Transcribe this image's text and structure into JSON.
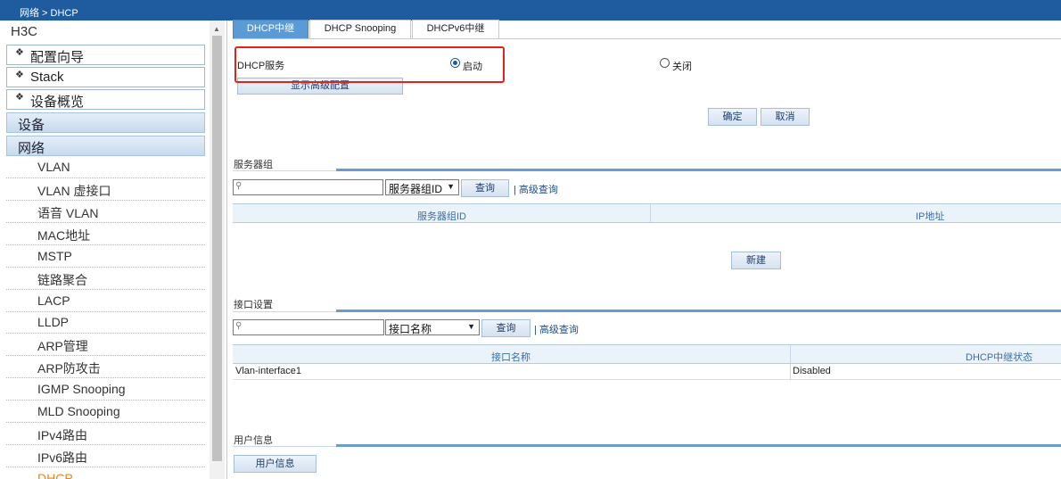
{
  "breadcrumb": "网络 > DHCP",
  "sidebar": {
    "brand": "H3C",
    "heads": [
      "配置向导",
      "Stack",
      "设备概览"
    ],
    "sections": [
      "设备",
      "网络"
    ],
    "items": [
      {
        "label": "VLAN"
      },
      {
        "label": "VLAN 虚接口"
      },
      {
        "label": "语音 VLAN"
      },
      {
        "label": "MAC地址"
      },
      {
        "label": "MSTP"
      },
      {
        "label": "链路聚合"
      },
      {
        "label": "LACP"
      },
      {
        "label": "LLDP"
      },
      {
        "label": "ARP管理"
      },
      {
        "label": "ARP防攻击"
      },
      {
        "label": "IGMP Snooping"
      },
      {
        "label": "MLD Snooping"
      },
      {
        "label": "IPv4路由"
      },
      {
        "label": "IPv6路由"
      },
      {
        "label": "DHCP"
      }
    ]
  },
  "tabs": [
    "DHCP中继",
    "DHCP Snooping",
    "DHCPv6中继"
  ],
  "service": {
    "label": "DHCP服务",
    "enable_label": "启动",
    "disable_label": "关闭",
    "selected": "启动"
  },
  "buttons": {
    "advanced": "显示高级配置",
    "ok": "确定",
    "cancel": "取消",
    "query": "查询",
    "new": "新建",
    "user_info": "用户信息"
  },
  "server_group": {
    "title": "服务器组",
    "search_value": "",
    "select_value": "服务器组ID",
    "advanced_link": "| 高级查询",
    "columns": [
      "服务器组ID",
      "IP地址"
    ]
  },
  "interface": {
    "title": "接口设置",
    "search_value": "",
    "select_value": "接口名称",
    "advanced_link": "| 高级查询",
    "columns": [
      "接口名称",
      "DHCP中继状态"
    ],
    "rows": [
      {
        "name": "Vlan-interface1",
        "status": "Disabled"
      }
    ]
  },
  "user_section": {
    "title": "用户信息"
  },
  "colors": {
    "topbar": "#1f5c9f",
    "active_tab": "#5b9bd5",
    "highlight": "#e2231a",
    "active_nav": "#e8831a"
  }
}
